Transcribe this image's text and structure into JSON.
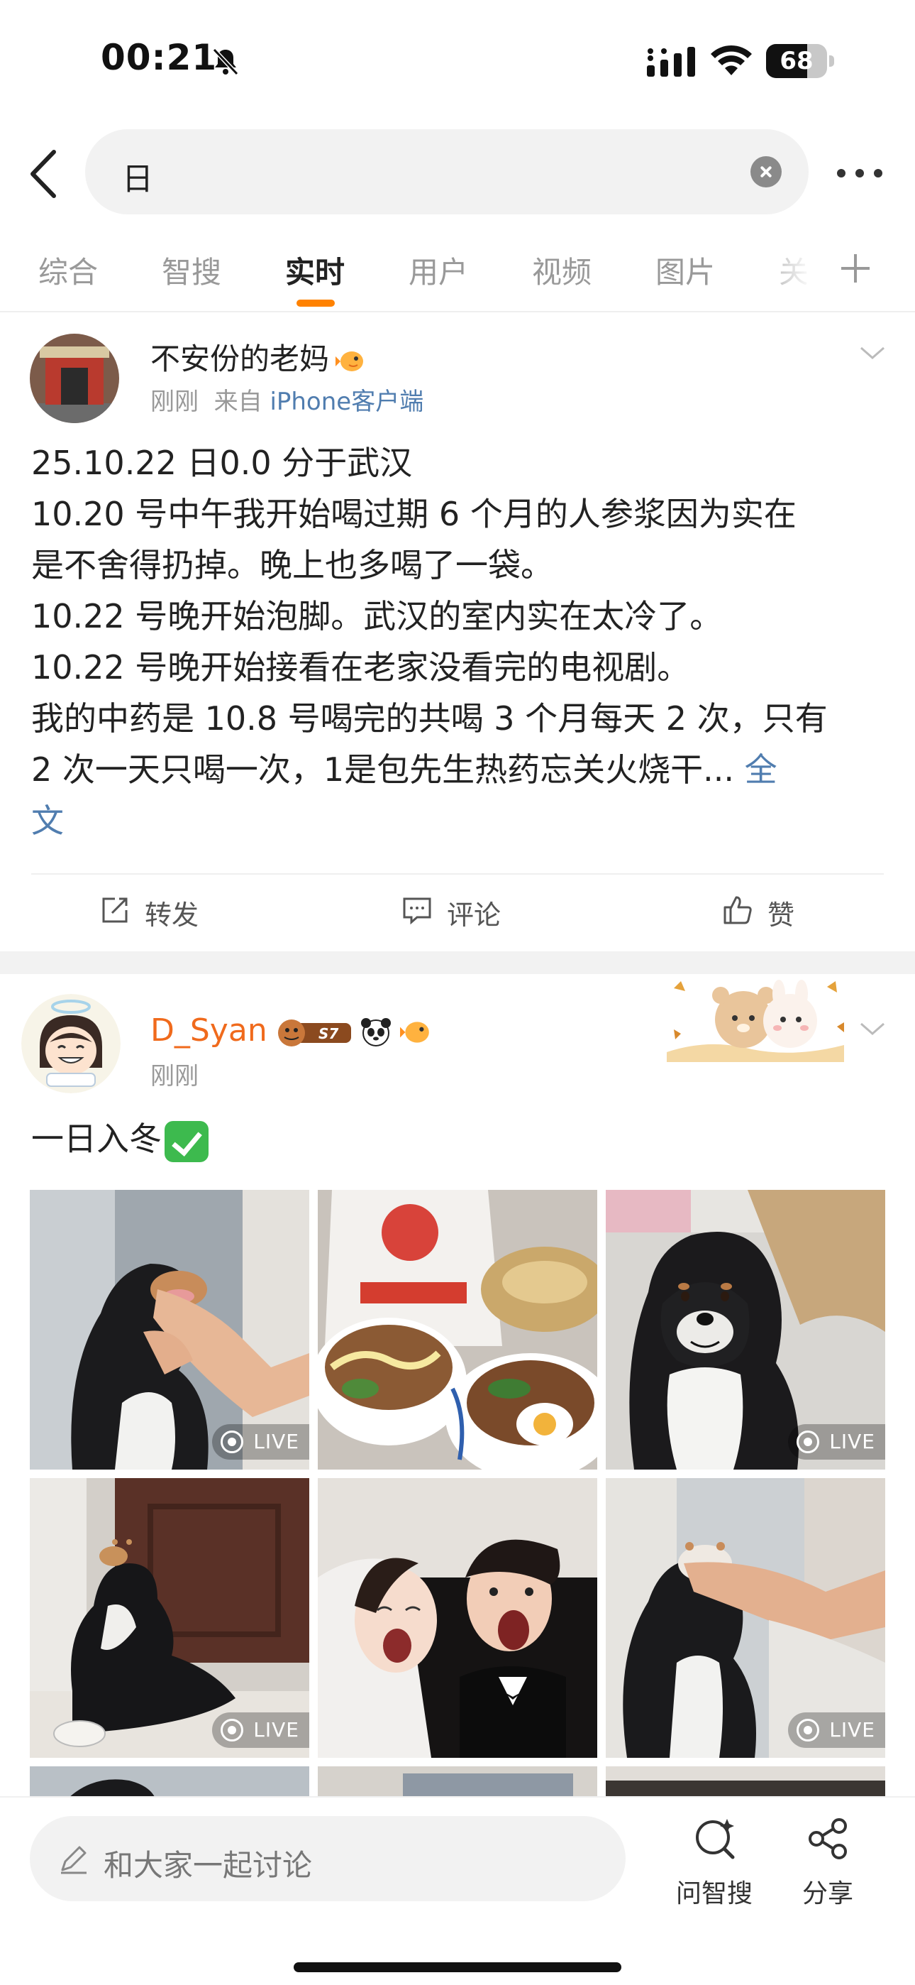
{
  "status_bar": {
    "time": "00:21",
    "battery": "68",
    "battery_level": 0.68
  },
  "search": {
    "query": "日"
  },
  "tabs": [
    {
      "label": "综合"
    },
    {
      "label": "智搜"
    },
    {
      "label": "实时"
    },
    {
      "label": "用户"
    },
    {
      "label": "视频"
    },
    {
      "label": "图片"
    },
    {
      "label": "关"
    }
  ],
  "active_tab": "实时",
  "post1": {
    "username": "不安份的老妈",
    "time": "刚刚",
    "source_prefix": "来自",
    "source": "iPhone客户端",
    "lines": [
      "25.10.22 日0.0 分于武汉",
      "10.20 号中午我开始喝过期 6 个月的人参浆因为实在",
      "是不舍得扔掉。晚上也多喝了一袋。",
      "10.22 号晚开始泡脚。武汉的室内实在太冷了。",
      "10.22 号晚开始接看在老家没看完的电视剧。",
      "我的中药是 10.8 号喝完的共喝 3 个月每天 2 次，只有",
      "2 次一天只喝一次，1是包先生热药忘关火烧干... "
    ],
    "full_text_label_1": "全",
    "full_text_label_2": "文",
    "actions": {
      "repost": "转发",
      "comment": "评论",
      "like": "赞"
    }
  },
  "post2": {
    "username": "D_Syan",
    "level_badge": "S7",
    "time": "刚刚",
    "text": "一日入冬",
    "photos": [
      {
        "icon": "dog-photo",
        "live": true
      },
      {
        "icon": "food-photo",
        "live": false
      },
      {
        "icon": "dog-photo",
        "live": true
      },
      {
        "icon": "dog-photo",
        "live": true
      },
      {
        "icon": "wedding-photo",
        "live": false
      },
      {
        "icon": "dog-photo",
        "live": true
      }
    ],
    "live_label": "LIVE"
  },
  "bottom_bar": {
    "comment_placeholder": "和大家一起讨论",
    "ask_label": "问智搜",
    "share_label": "分享"
  },
  "colors": {
    "accent": "#ff8200",
    "link": "#507daf",
    "username_vip": "#f06a1c"
  }
}
